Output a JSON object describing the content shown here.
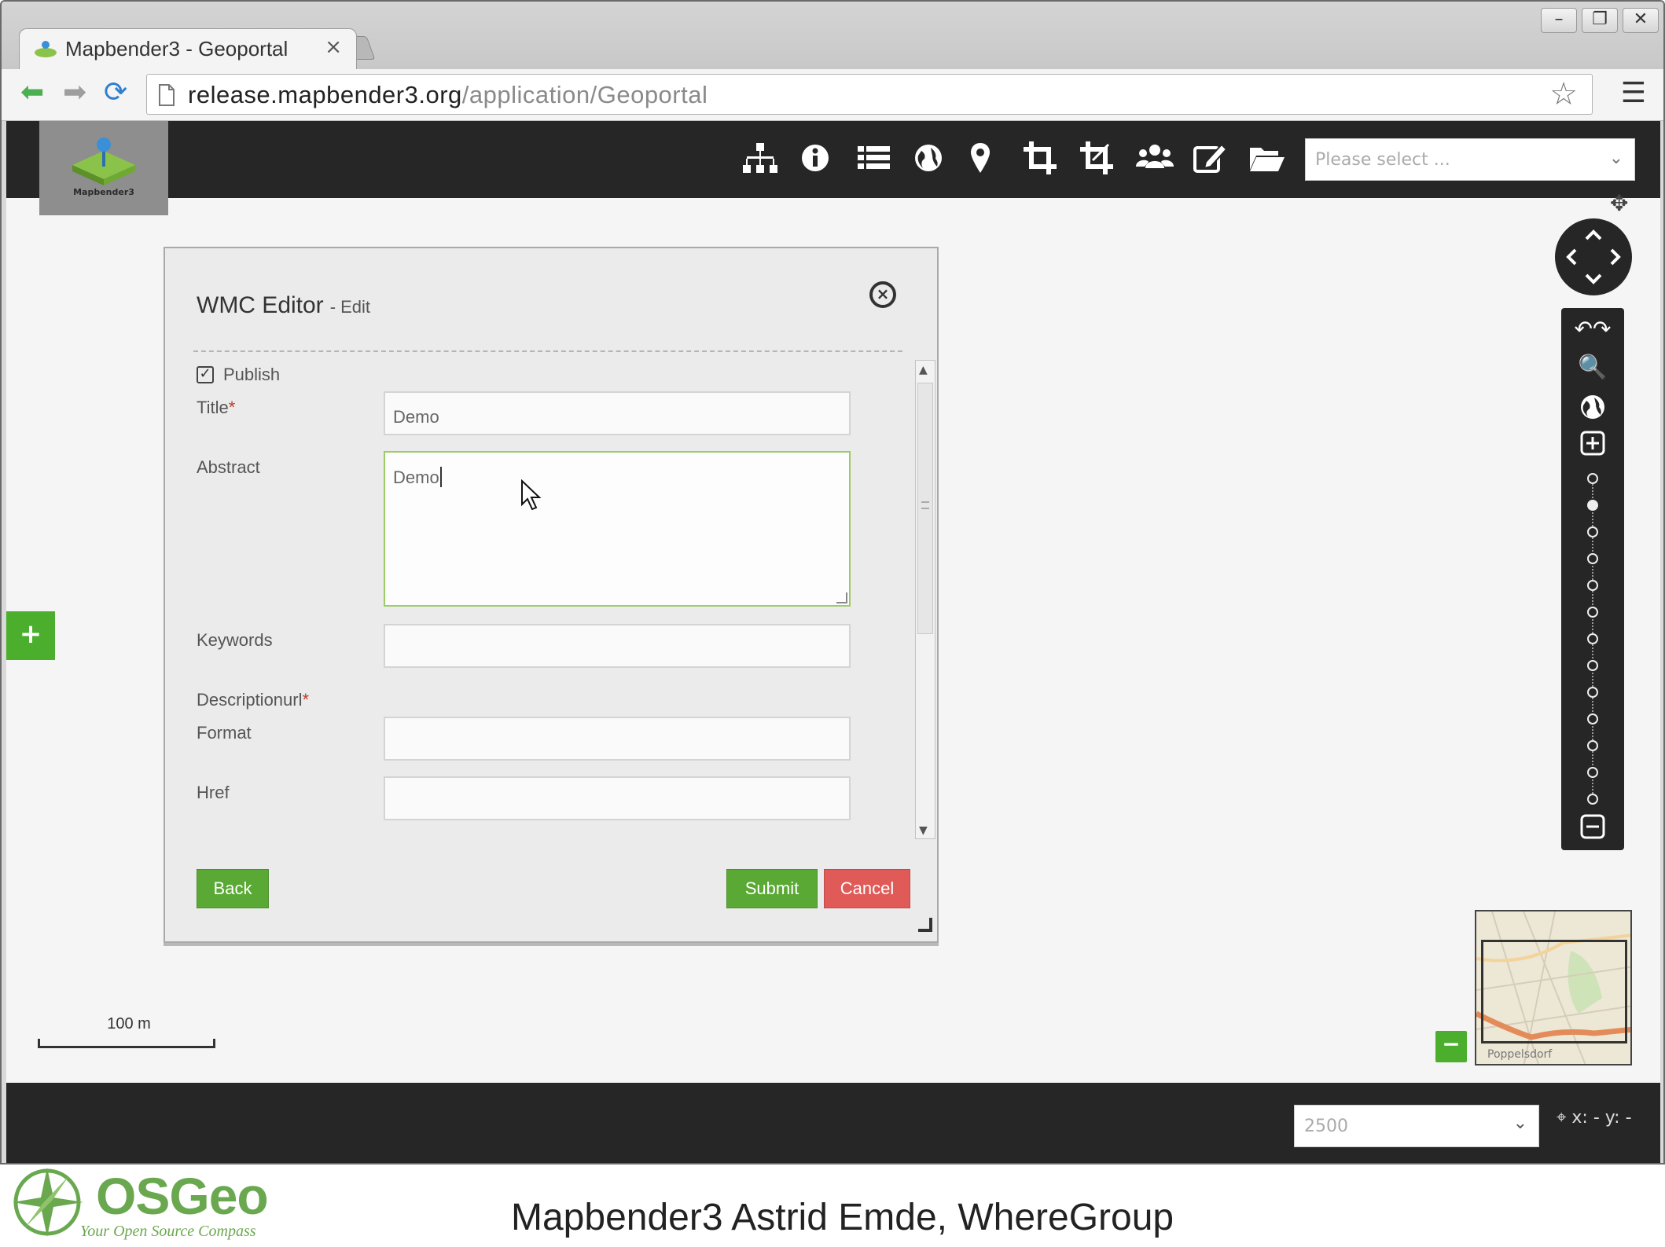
{
  "browser": {
    "tab_title": "Mapbender3 - Geoportal",
    "tab_close": "×",
    "url_host": "release.mapbender3.org",
    "url_path": "/application/Geoportal",
    "window_buttons": [
      "–",
      "❐",
      "✕"
    ]
  },
  "app": {
    "logo_text": "Mapbender3",
    "toolbar_icons": [
      "sitemap-icon",
      "info-icon",
      "list-icon",
      "globe-icon",
      "map-marker-icon",
      "crop-icon",
      "crop-alt-icon",
      "users-icon",
      "edit-icon",
      "folder-open-icon"
    ],
    "select_placeholder": "Please select ...",
    "dialog": {
      "title": "WMC Editor",
      "subtitle": "- Edit",
      "publish_label": "Publish",
      "publish_checked": true,
      "title_label": "Title",
      "title_value": "Demo",
      "abstract_label": "Abstract",
      "abstract_value": "Demo",
      "keywords_label": "Keywords",
      "keywords_value": "",
      "descriptionurl_label": "Descriptionurl",
      "format_label": "Format",
      "format_value": "",
      "href_label": "Href",
      "href_value": "",
      "required_mark": "*",
      "back_label": "Back",
      "submit_label": "Submit",
      "cancel_label": "Cancel"
    },
    "left_toggle": "+",
    "overview_label": "Poppelsdorf",
    "overview_toggle": "−",
    "scalebar_label": "100 m",
    "scale_select_value": "2500",
    "coords_text": "x: - y: -"
  },
  "slide": {
    "osgeo_name": "OSGeo",
    "osgeo_tagline": "Your Open Source Compass",
    "credit": "Mapbender3 Astrid Emde, WhereGroup"
  },
  "colors": {
    "accent_green": "#5aa935",
    "cancel_red": "#e05a58",
    "toolbar_dark": "#262626"
  }
}
